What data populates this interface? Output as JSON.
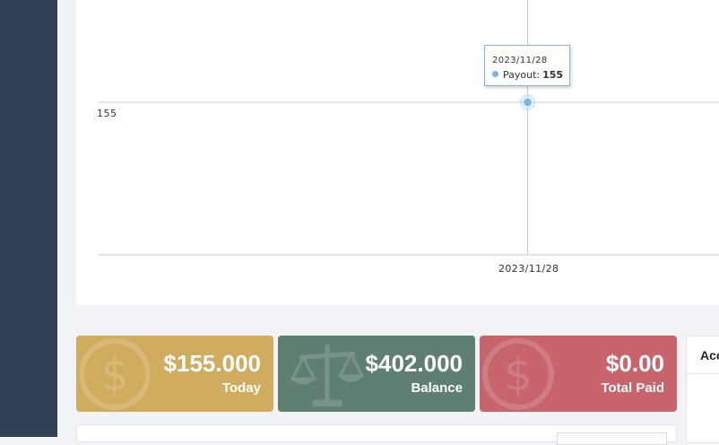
{
  "chart_data": {
    "type": "line",
    "x": [
      "2023/11/28"
    ],
    "series": [
      {
        "name": "Payout",
        "values": [
          155
        ]
      }
    ],
    "y_tick_labels": [
      "155"
    ],
    "x_tick_labels": [
      "2023/11/28"
    ],
    "grid": true,
    "tooltip": {
      "date": "2023/11/28",
      "series_name": "Payout",
      "value": "155"
    }
  },
  "colors": {
    "sidebar": "#324256",
    "series": "#7cb5ec",
    "today_card": "#d0ac5f",
    "balance_card": "#5e7f72",
    "paid_card": "#c7646c"
  },
  "cards": [
    {
      "amount": "$155.000",
      "label": "Today",
      "icon": "dollar-icon"
    },
    {
      "amount": "$402.000",
      "label": "Balance",
      "icon": "scale-icon"
    },
    {
      "amount": "$0.00",
      "label": "Total Paid",
      "icon": "dollar-icon"
    }
  ],
  "side_panel": {
    "title": "Acc"
  }
}
